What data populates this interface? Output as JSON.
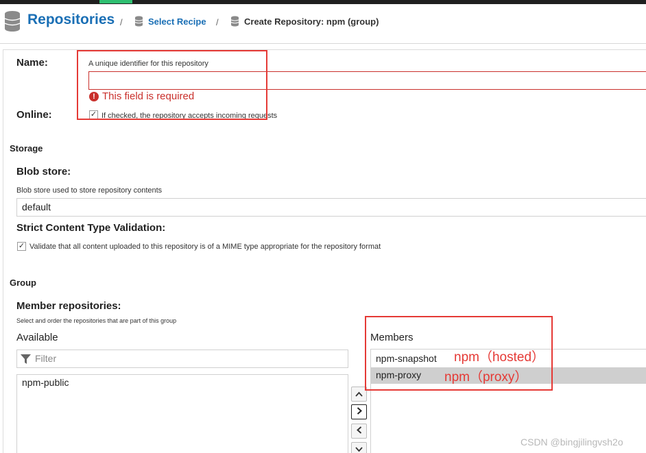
{
  "header": {
    "title": "Repositories",
    "separator": "/",
    "crumb_select": "Select Recipe",
    "crumb_current": "Create Repository: npm (group)"
  },
  "name": {
    "label": "Name:",
    "help": "A unique identifier for this repository",
    "value": "",
    "error_icon": "!",
    "error": "This field is required"
  },
  "online": {
    "label": "Online:",
    "checked_glyph": "✓",
    "help": "If checked, the repository accepts incoming requests"
  },
  "storage": {
    "section": "Storage",
    "blob_label": "Blob store:",
    "blob_help": "Blob store used to store repository contents",
    "blob_value": "default",
    "strict_label": "Strict Content Type Validation:",
    "strict_checked_glyph": "✓",
    "strict_help": "Validate that all content uploaded to this repository is of a MIME type appropriate for the repository format"
  },
  "group": {
    "section": "Group",
    "member_label": "Member repositories:",
    "member_help": "Select and order the repositories that are part of this group",
    "available_label": "Available",
    "filter_placeholder": "Filter",
    "filter_icon": "filter-icon",
    "available_items": [
      "npm-public"
    ],
    "members_label": "Members",
    "members": [
      "npm-snapshot",
      "npm-proxy"
    ],
    "buttons": {
      "up": "^",
      "add": ">",
      "remove": "<",
      "down": "v"
    }
  },
  "annotations": {
    "hosted": "npm（hosted）",
    "proxy": "npm（proxy）",
    "color": "#e53935"
  },
  "watermark": "CSDN @bingjilingvsh2o",
  "colors": {
    "brand": "#1a6fb5",
    "error": "#c9302c",
    "accent": "#2fbf71"
  }
}
